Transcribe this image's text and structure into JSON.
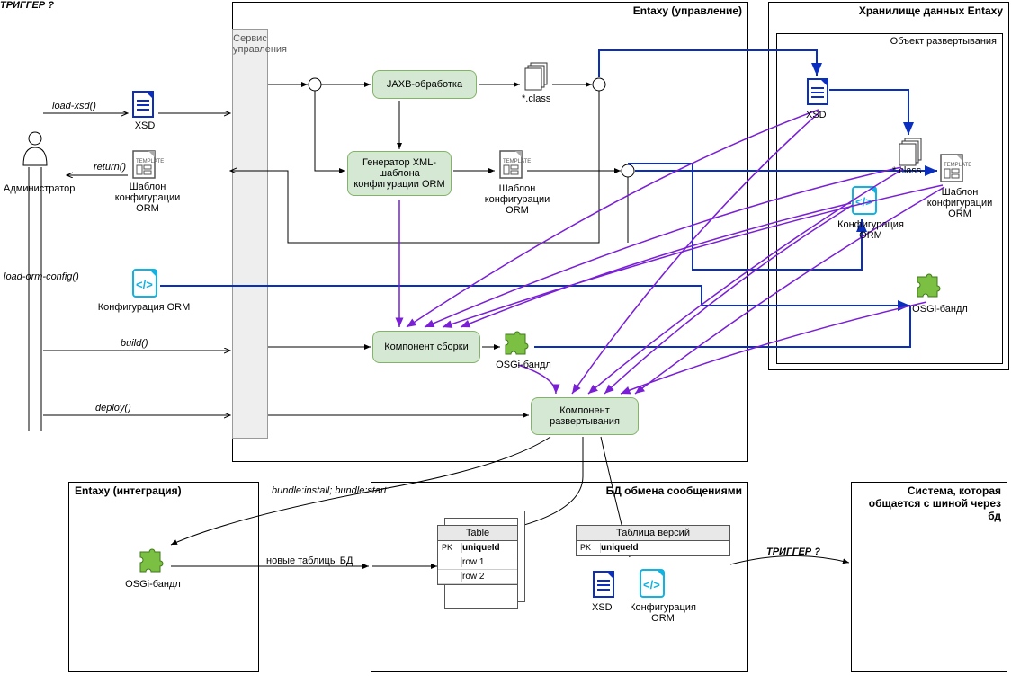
{
  "actors": {
    "admin": "Администратор"
  },
  "calls": {
    "load_xsd": "load-xsd()",
    "return": "return()",
    "load_orm": "load-orm-config()",
    "build": "build()",
    "deploy": "deploy()",
    "bundle": "bundle:install; bundle:start",
    "new_tables": "новые таблицы БД",
    "trigger": "ТРИГГЕР ?"
  },
  "artifacts": {
    "xsd": "XSD",
    "template": "Шаблон конфигурации ORM",
    "orm_config": "Конфигурация ORM",
    "star_class": "*.class",
    "osgi_bundle": "OSGi-бандл"
  },
  "containers": {
    "entaxy_mgmt": "Entaxy (управление)",
    "storage": "Хранилище данных Entaxy",
    "deploy_obj": "Объект развертывания",
    "entaxy_int": "Entaxy (интеграция)",
    "msg_db": "БД обмена сообщениями",
    "ext_system": "Система, которая общается с шиной через бд",
    "service_col": "Сервис управления"
  },
  "components": {
    "jaxb": "JAXB-обработка",
    "xml_gen": "Генератор XML-шаблона конфигурации ORM",
    "assembler": "Компонент сборки",
    "deployer": "Компонент развертывания"
  },
  "tables": {
    "table_header": "Table",
    "pk": "PK",
    "uniqueId": "uniqueId",
    "row1": "row 1",
    "row2": "row 2",
    "versions": "Таблица версий"
  }
}
